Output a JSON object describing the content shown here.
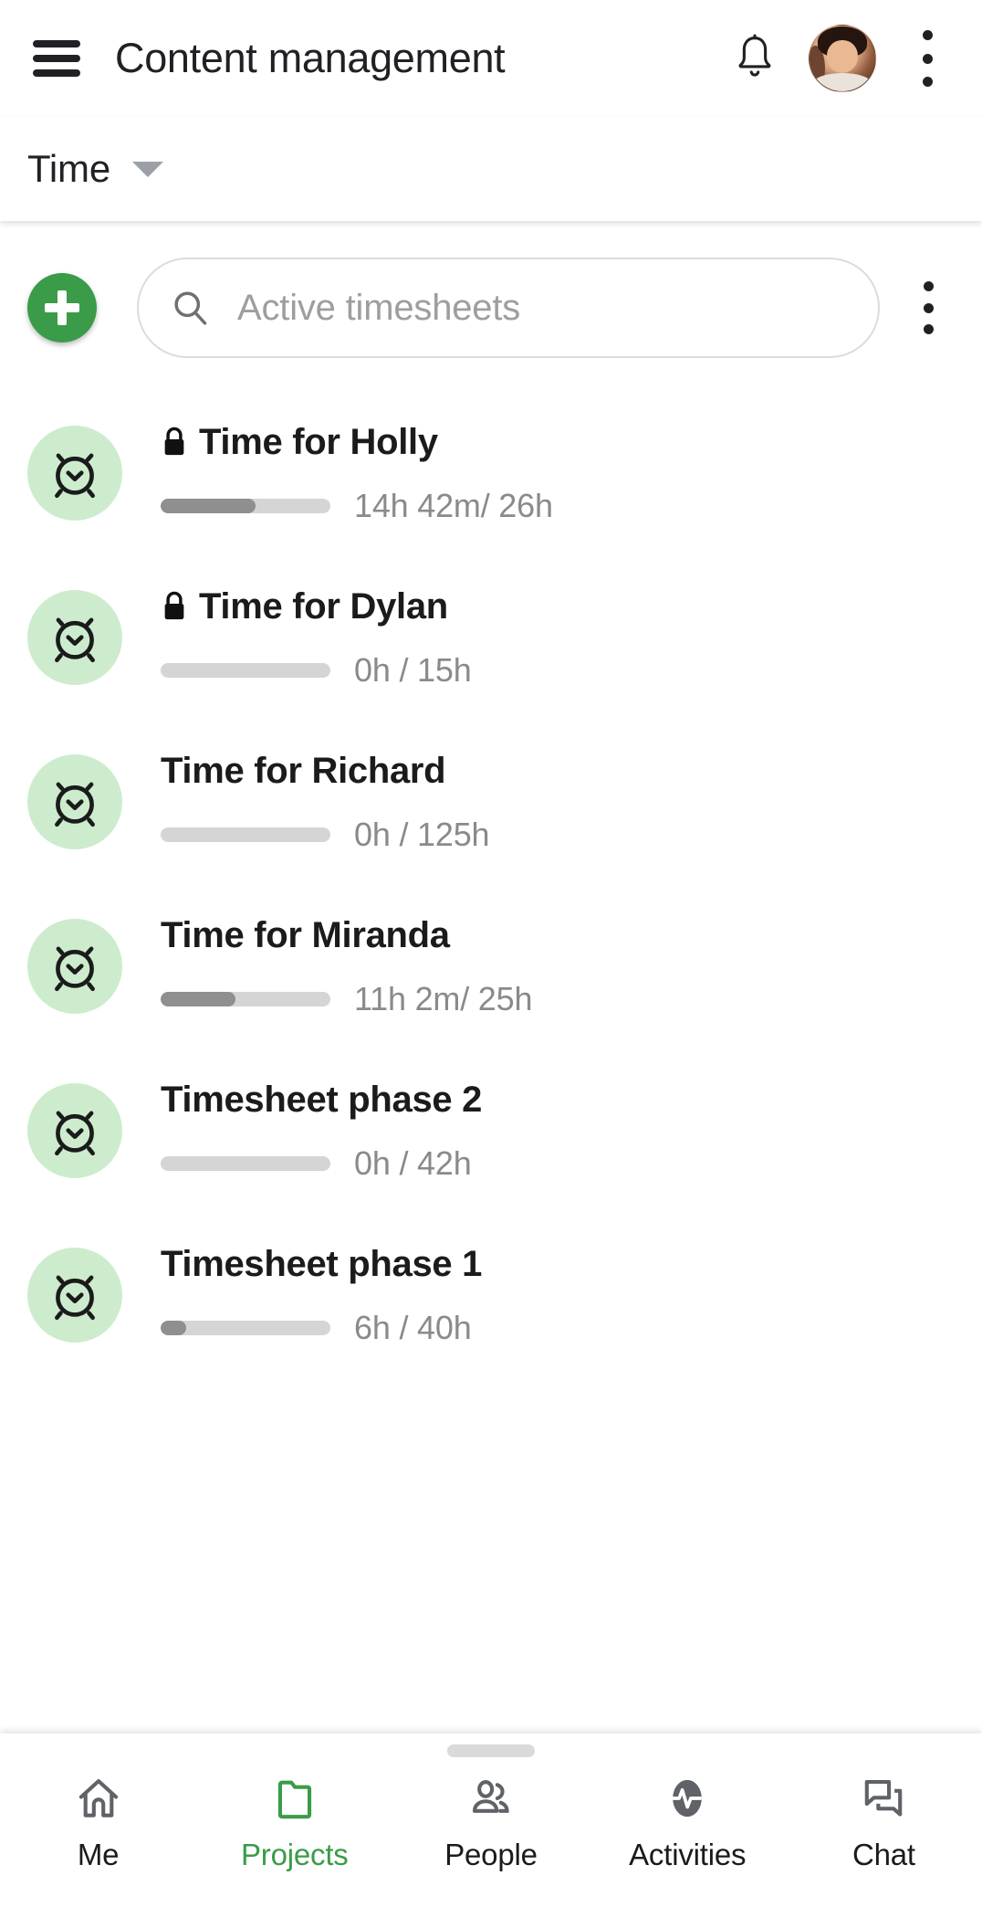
{
  "appbar": {
    "menu_label": "menu",
    "title": "Content management",
    "notifications_label": "Notifications",
    "avatar_label": "Account",
    "overflow_label": "More options"
  },
  "subheader": {
    "label": "Time",
    "caret_label": "Expand"
  },
  "toolbar": {
    "add_label": "+",
    "search_placeholder": "Active timesheets",
    "search_value": "",
    "overflow_label": "More options"
  },
  "list": {
    "items": [
      {
        "icon": "alarm-clock-icon",
        "locked": true,
        "title": "Time for Holly",
        "hours": "14h 42m/ 26h",
        "progress_percent": 56
      },
      {
        "icon": "alarm-clock-icon",
        "locked": true,
        "title": "Time for Dylan",
        "hours": "0h / 15h",
        "progress_percent": 0
      },
      {
        "icon": "alarm-clock-icon",
        "locked": false,
        "title": "Time for Richard",
        "hours": "0h / 125h",
        "progress_percent": 0
      },
      {
        "icon": "alarm-clock-icon",
        "locked": false,
        "title": "Time for Miranda",
        "hours": "11h 2m/ 25h",
        "progress_percent": 44
      },
      {
        "icon": "alarm-clock-icon",
        "locked": false,
        "title": "Timesheet phase 2",
        "hours": "0h / 42h",
        "progress_percent": 0
      },
      {
        "icon": "alarm-clock-icon",
        "locked": false,
        "title": "Timesheet phase 1",
        "hours": "6h / 40h",
        "progress_percent": 15
      }
    ]
  },
  "bottomnav": {
    "items": [
      {
        "label": "Me",
        "icon": "home-icon",
        "active": false
      },
      {
        "label": "Projects",
        "icon": "folder-icon",
        "active": true
      },
      {
        "label": "People",
        "icon": "people-icon",
        "active": false
      },
      {
        "label": "Activities",
        "icon": "activity-icon",
        "active": false
      },
      {
        "label": "Chat",
        "icon": "chat-icon",
        "active": false
      }
    ]
  },
  "colors": {
    "accent_green": "#3a9c48",
    "icon_bubble_green": "#cdeccd",
    "text_primary": "#1b1b1b",
    "text_muted": "#8a8a8a",
    "nav_icon": "#5f6368"
  }
}
